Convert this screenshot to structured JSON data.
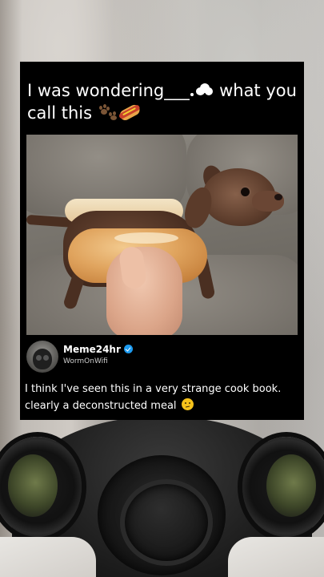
{
  "post": {
    "caption": {
      "before": "I was wondering___.",
      "after": " what you call this "
    },
    "caption_emojis": [
      "thought-balloon",
      "paw-prints",
      "hot-dog"
    ],
    "image_alt": "A small dachshund puppy placed inside a hot dog bun held by a hand on a couch",
    "author": {
      "name": "Meme24hr",
      "handle": "WormOnWifi",
      "verified": true
    },
    "body_text": "I think I've seen this in a very strange cook book. clearly a deconstructed meal",
    "body_emoji": "thinking-face"
  },
  "colors": {
    "card_background": "#000000",
    "verified_badge": "#1d9bf0",
    "text": "#ffffff"
  }
}
